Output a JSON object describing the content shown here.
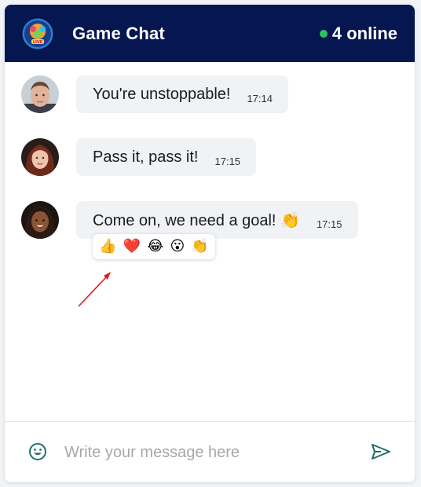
{
  "header": {
    "title": "Game Chat",
    "online_text": "4 online",
    "logo_icon": "live-game-logo-icon"
  },
  "messages": [
    {
      "text": "You're unstoppable!",
      "time": "17:14",
      "avatar": "avatar-man"
    },
    {
      "text": "Pass it, pass it!",
      "time": "17:15",
      "avatar": "avatar-woman-red-hair"
    },
    {
      "text": "Come on, we need a goal! 👏",
      "time": "17:15",
      "avatar": "avatar-woman-curly-hair"
    }
  ],
  "reactions": [
    "👍",
    "❤️",
    "😂",
    "😮",
    "👏"
  ],
  "input": {
    "placeholder": "Write your message here",
    "value": ""
  },
  "colors": {
    "header_bg": "#061651",
    "online_dot": "#2fc25b",
    "bubble_bg": "#f0f2f6",
    "accent_icon": "#1f6f6b",
    "arrow": "#e31b1b"
  }
}
